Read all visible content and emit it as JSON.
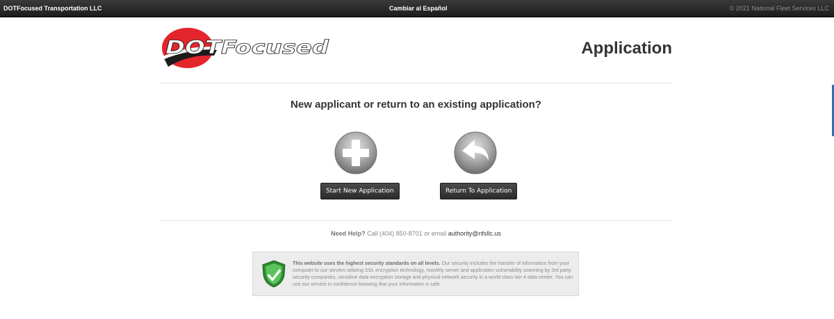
{
  "topbar": {
    "company": "DOTFocused Transportation LLC",
    "language_link": "Cambiar al Español",
    "copyright": "© 2021 National Fleet Services LLC"
  },
  "header": {
    "logo_text": "DOTFocused",
    "title": "Application"
  },
  "main": {
    "question": "New applicant or return to an existing application?",
    "start_button": "Start New Application",
    "return_button": "Return To Application"
  },
  "help": {
    "label": "Need Help?",
    "text": "Call (404) 850-8701 or email",
    "email": "authority@nfsllc.us"
  },
  "security": {
    "heading": "This website uses the highest security standards on all levels.",
    "body": "Our security includes the transfer of information from your computer to our servers utilizing SSL encryption technology, monthly server and application vulnerability scanning by 3rd party security companies, sensitive data encryption storage and physical network security in a world class tier-4 data center. You can use our service in confidence knowing that your information is safe."
  },
  "colors": {
    "topbar": "#2a2a2a",
    "logo_red": "#e4252b",
    "button": "#333333",
    "shield_green": "#3cab3c"
  },
  "icons": [
    "plus-circle-icon",
    "return-arrow-icon",
    "security-shield-icon"
  ]
}
